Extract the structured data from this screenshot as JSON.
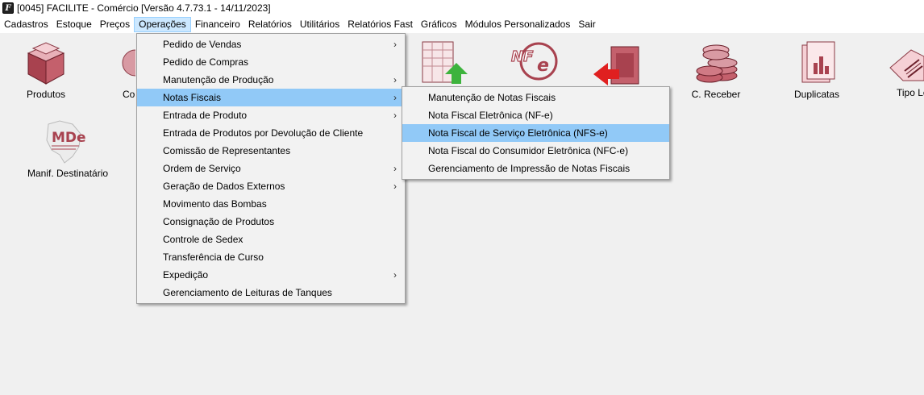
{
  "window": {
    "title": "[0045] FACILITE - Comércio [Versão 4.7.73.1 - 14/11/2023]",
    "icon_glyph": "F"
  },
  "menubar": [
    {
      "label": "Cadastros"
    },
    {
      "label": "Estoque"
    },
    {
      "label": "Preços"
    },
    {
      "label": "Operações",
      "active": true
    },
    {
      "label": "Financeiro"
    },
    {
      "label": "Relatórios"
    },
    {
      "label": "Utilitários"
    },
    {
      "label": "Relatórios Fast"
    },
    {
      "label": "Gráficos"
    },
    {
      "label": "Módulos Personalizados"
    },
    {
      "label": "Sair"
    }
  ],
  "desktop": {
    "produtos": "Produtos",
    "compras_partial": "Cor",
    "c_receber": "C. Receber",
    "duplicatas": "Duplicatas",
    "tipo_partial": "Tipo Lo",
    "manif": "Manif. Destinatário",
    "mde_logo": "MDe",
    "nfe_logo": "NF-e"
  },
  "operacoes_menu": [
    {
      "label": "Pedido de Vendas",
      "submenu": true
    },
    {
      "label": "Pedido de Compras",
      "submenu": false
    },
    {
      "label": "Manutenção de Produção",
      "submenu": true
    },
    {
      "label": "Notas Fiscais",
      "submenu": true,
      "highlighted": true
    },
    {
      "label": "Entrada de Produto",
      "submenu": true
    },
    {
      "label": "Entrada de Produtos por Devolução de Cliente",
      "submenu": false
    },
    {
      "label": "Comissão de Representantes",
      "submenu": false
    },
    {
      "label": "Ordem de Serviço",
      "submenu": true
    },
    {
      "label": "Geração de Dados Externos",
      "submenu": true
    },
    {
      "label": "Movimento das Bombas",
      "submenu": false
    },
    {
      "label": "Consignação de Produtos",
      "submenu": false
    },
    {
      "label": "Controle de Sedex",
      "submenu": false
    },
    {
      "label": "Transferência de Curso",
      "submenu": false
    },
    {
      "label": "Expedição",
      "submenu": true
    },
    {
      "label": "Gerenciamento de Leituras de Tanques",
      "submenu": false
    }
  ],
  "notas_submenu": [
    {
      "label": "Manutenção de Notas Fiscais"
    },
    {
      "label": "Nota Fiscal Eletrônica (NF-e)"
    },
    {
      "label": "Nota Fiscal de Serviço Eletrônica (NFS-e)",
      "highlighted": true
    },
    {
      "label": "Nota Fiscal do Consumidor Eletrônica (NFC-e)"
    },
    {
      "label": "Gerenciamento de Impressão de Notas Fiscais"
    }
  ],
  "arrow_glyph": "›",
  "colors": {
    "menu_highlight": "#91c9f7",
    "menubar_active": "#cce8ff",
    "background": "#f0f0f0"
  }
}
